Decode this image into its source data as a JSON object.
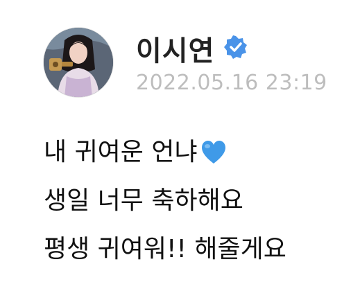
{
  "post": {
    "author_name": "이시연",
    "verified_badge_icon": "verified-check-icon",
    "timestamp": "2022.05.16 23:19",
    "avatar_icon": "profile-photo",
    "message_lines": [
      "내 귀여운 언냐",
      "생일 너무 축하해요",
      "평생 귀여워!! 해줄게요"
    ],
    "emoji_icon": "blue-heart-icon"
  },
  "colors": {
    "verified": "#4a93e8",
    "heart": "#3f9ae8",
    "timestamp": "#bdbdbd",
    "text": "#111111"
  }
}
